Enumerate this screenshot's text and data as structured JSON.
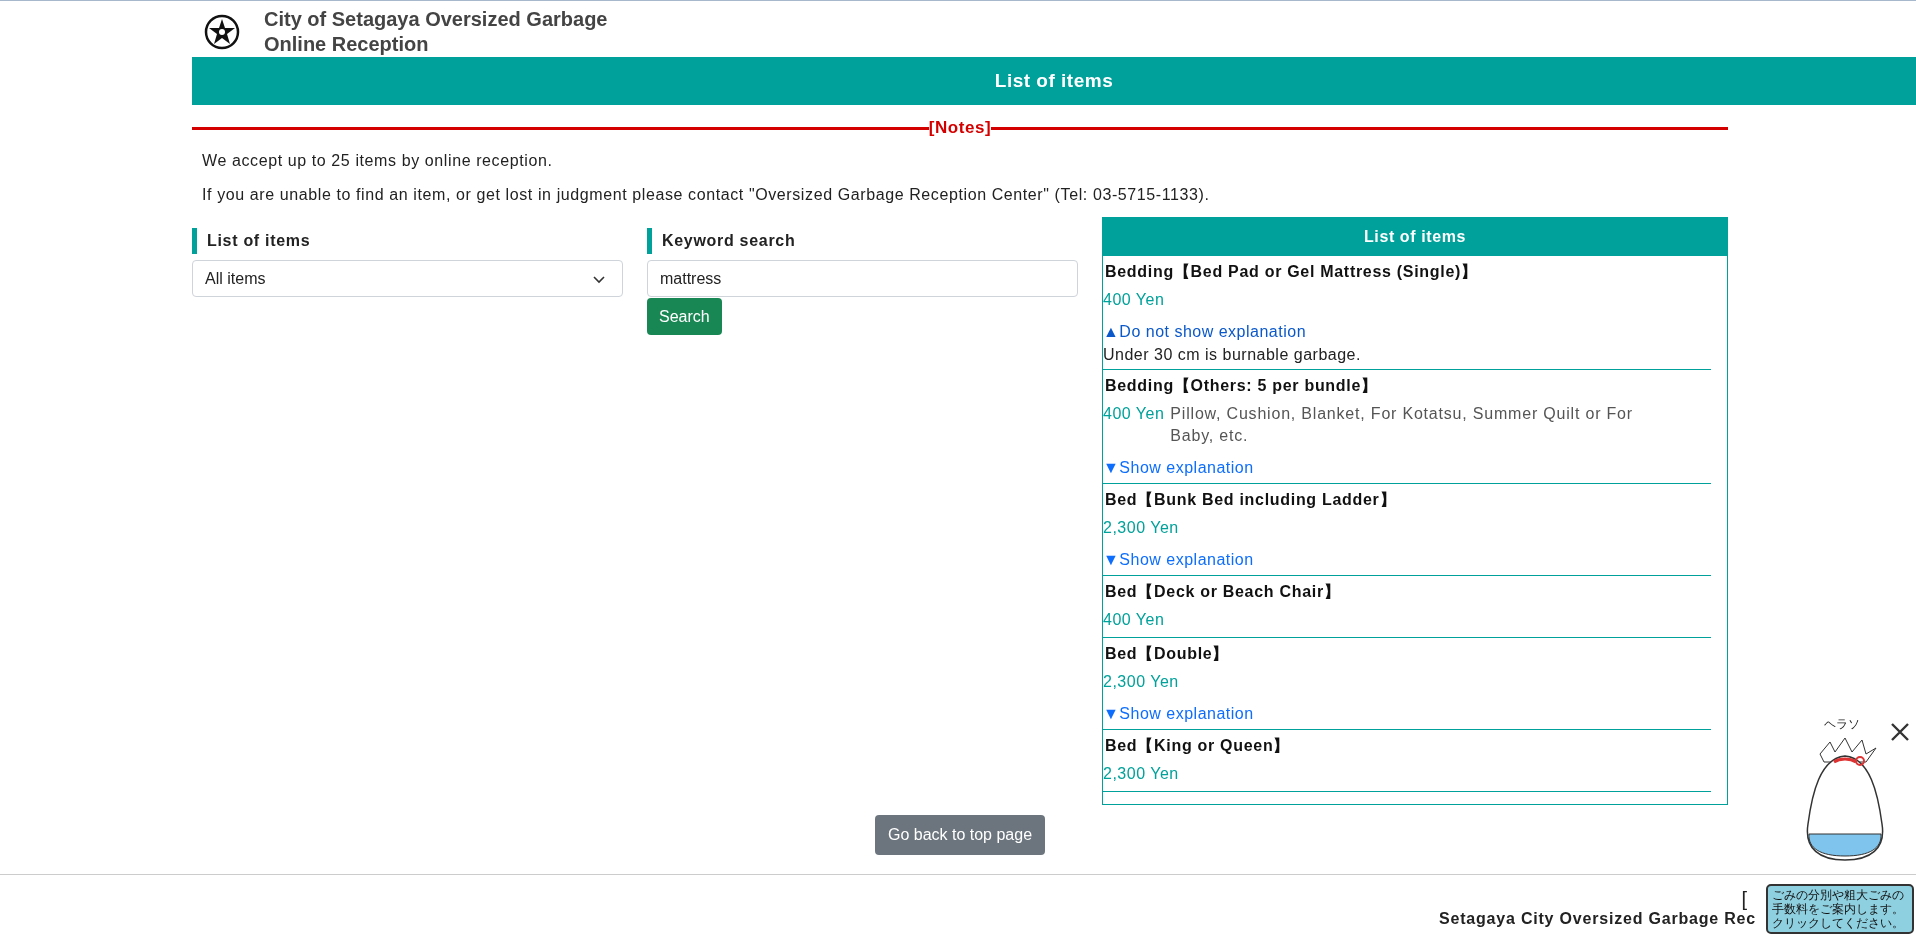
{
  "header": {
    "title": "City of Setagaya Oversized Garbage Online Reception"
  },
  "page_bar": {
    "title": "List of items"
  },
  "notes": {
    "heading": "[Notes]",
    "lines": [
      "We accept up to 25 items by online reception.",
      "If you are unable to find an item, or get lost in judgment please contact \"Oversized Garbage Reception Center\" (Tel: 03-5715-1133)."
    ]
  },
  "category_filter": {
    "heading": "List of items",
    "value": "All items"
  },
  "keyword_search": {
    "heading": "Keyword search",
    "value": "mattress",
    "button": "Search"
  },
  "results": {
    "heading": "List of items",
    "items": [
      {
        "name": "Bedding【Bed Pad or Gel Mattress (Single)】",
        "price": "400 Yen",
        "toggle": {
          "label": "▲Do not show explanation",
          "expanded": true
        },
        "explanation": "Under 30 cm is burnable garbage."
      },
      {
        "name": "Bedding【Others: 5 per bundle】",
        "price": "400 Yen",
        "description": "Pillow, Cushion, Blanket, For Kotatsu, Summer Quilt or For Baby, etc.",
        "toggle": {
          "label": "▼Show explanation",
          "expanded": false
        }
      },
      {
        "name": "Bed【Bunk Bed including Ladder】",
        "price": "2,300 Yen",
        "toggle": {
          "label": "▼Show explanation",
          "expanded": false
        }
      },
      {
        "name": "Bed【Deck or Beach Chair】",
        "price": "400 Yen"
      },
      {
        "name": "Bed【Double】",
        "price": "2,300 Yen",
        "toggle": {
          "label": "▼Show explanation",
          "expanded": false
        }
      },
      {
        "name": "Bed【King or Queen】",
        "price": "2,300 Yen"
      }
    ]
  },
  "back_button": "Go back to top page",
  "footer": {
    "bracket": "[",
    "text": "Setagaya City Oversized Garbage Rec"
  },
  "mascot": {
    "label": "ヘラソ",
    "bubble": "ごみの分別や粗大ごみの手数料をご案内します。クリックしてください。"
  }
}
